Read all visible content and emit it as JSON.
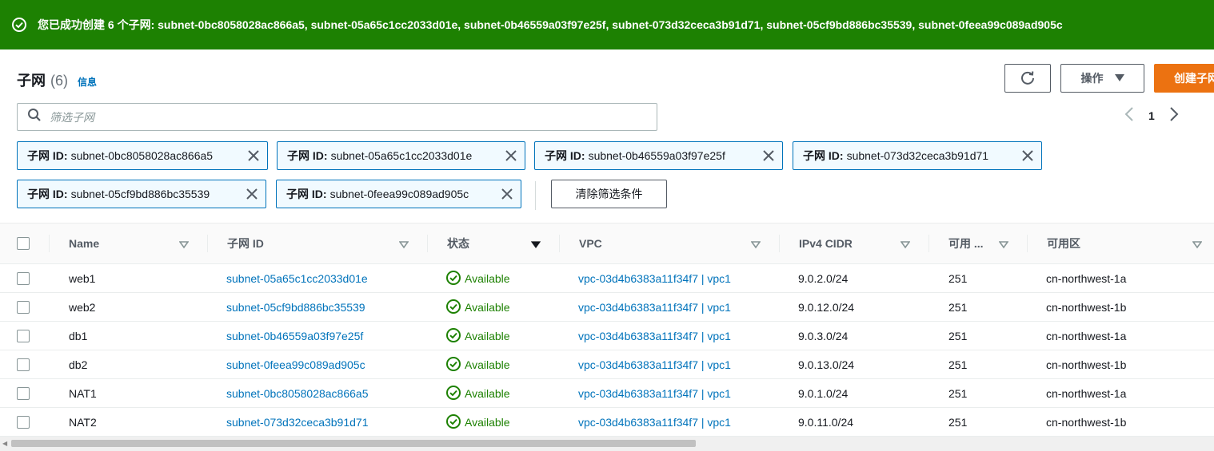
{
  "banner": {
    "message": "您已成功创建 6 个子网: subnet-0bc8058028ac866a5, subnet-05a65c1cc2033d01e, subnet-0b46559a03f97e25f, subnet-073d32ceca3b91d71, subnet-05cf9bd886bc35539, subnet-0feea99c089ad905c"
  },
  "header": {
    "title": "子网",
    "count": "(6)",
    "info": "信息",
    "actions_label": "操作",
    "create_label": "创建子网"
  },
  "search": {
    "placeholder": "筛选子网"
  },
  "pagination": {
    "page": "1"
  },
  "filters": [
    {
      "key": "子网 ID:",
      "value": "subnet-0bc8058028ac866a5"
    },
    {
      "key": "子网 ID:",
      "value": "subnet-05a65c1cc2033d01e"
    },
    {
      "key": "子网 ID:",
      "value": "subnet-0b46559a03f97e25f"
    },
    {
      "key": "子网 ID:",
      "value": "subnet-073d32ceca3b91d71"
    },
    {
      "key": "子网 ID:",
      "value": "subnet-05cf9bd886bc35539"
    },
    {
      "key": "子网 ID:",
      "value": "subnet-0feea99c089ad905c"
    }
  ],
  "clear_filters_label": "清除筛选条件",
  "columns": [
    "Name",
    "子网 ID",
    "状态",
    "VPC",
    "IPv4 CIDR",
    "可用 ...",
    "可用区"
  ],
  "rows": [
    {
      "name": "web1",
      "subnet_id": "subnet-05a65c1cc2033d01e",
      "status": "Available",
      "vpc": "vpc-03d4b6383a11f34f7 | vpc1",
      "cidr": "9.0.2.0/24",
      "available_ips": "251",
      "az": "cn-northwest-1a"
    },
    {
      "name": "web2",
      "subnet_id": "subnet-05cf9bd886bc35539",
      "status": "Available",
      "vpc": "vpc-03d4b6383a11f34f7 | vpc1",
      "cidr": "9.0.12.0/24",
      "available_ips": "251",
      "az": "cn-northwest-1b"
    },
    {
      "name": "db1",
      "subnet_id": "subnet-0b46559a03f97e25f",
      "status": "Available",
      "vpc": "vpc-03d4b6383a11f34f7 | vpc1",
      "cidr": "9.0.3.0/24",
      "available_ips": "251",
      "az": "cn-northwest-1a"
    },
    {
      "name": "db2",
      "subnet_id": "subnet-0feea99c089ad905c",
      "status": "Available",
      "vpc": "vpc-03d4b6383a11f34f7 | vpc1",
      "cidr": "9.0.13.0/24",
      "available_ips": "251",
      "az": "cn-northwest-1b"
    },
    {
      "name": "NAT1",
      "subnet_id": "subnet-0bc8058028ac866a5",
      "status": "Available",
      "vpc": "vpc-03d4b6383a11f34f7 | vpc1",
      "cidr": "9.0.1.0/24",
      "available_ips": "251",
      "az": "cn-northwest-1a"
    },
    {
      "name": "NAT2",
      "subnet_id": "subnet-073d32ceca3b91d71",
      "status": "Available",
      "vpc": "vpc-03d4b6383a11f34f7 | vpc1",
      "cidr": "9.0.11.0/24",
      "available_ips": "251",
      "az": "cn-northwest-1b"
    }
  ],
  "colors": {
    "success": "#1d8102",
    "link": "#0073bb",
    "primary": "#ec7211"
  }
}
